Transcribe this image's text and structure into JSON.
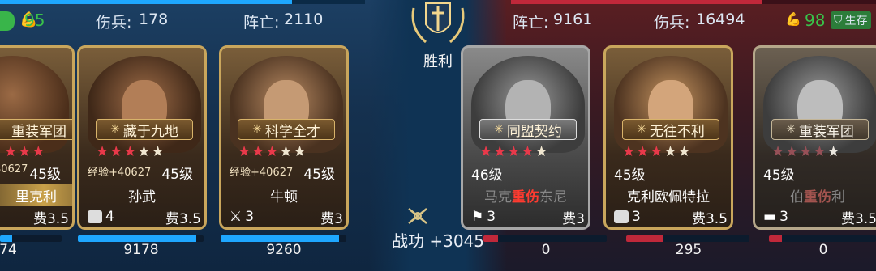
{
  "left": {
    "morale": "95",
    "wounded_label": "伤兵:",
    "wounded": "178",
    "dead_label": "阵亡:",
    "dead": "2110",
    "cards": [
      {
        "tag": "重装军团",
        "exp": "40627",
        "level": "45级",
        "name": "里克利",
        "troops": "",
        "cost": "费3.5",
        "hp": "74",
        "stars": 5,
        "stars_on": 3
      },
      {
        "tag": "藏于九地",
        "exp": "经验+40627",
        "level": "45级",
        "name": "孙武",
        "troops": "4",
        "cost": "费3.5",
        "hp": "9178",
        "stars": 5,
        "stars_on": 3
      },
      {
        "tag": "科学全才",
        "exp": "经验+40627",
        "level": "45级",
        "name": "牛顿",
        "troops": "3",
        "cost": "费3",
        "hp": "9260",
        "stars": 5,
        "stars_on": 3
      }
    ]
  },
  "center": {
    "result": "胜利",
    "merit_label": "战功",
    "merit_value": "+3045"
  },
  "right": {
    "dead_label": "阵亡:",
    "dead": "9161",
    "wounded_label": "伤兵:",
    "wounded": "16494",
    "morale": "98",
    "survive_label": "生存",
    "cards": [
      {
        "tag": "同盟契约",
        "level": "46级",
        "name_faded": "马克",
        "status": "重伤",
        "name_faded2": "东尼",
        "troops": "3",
        "cost": "费3",
        "hp": "0",
        "stars": 5,
        "stars_on": 4
      },
      {
        "tag": "无往不利",
        "level": "45级",
        "name": "克利欧佩特拉",
        "troops": "3",
        "cost": "费3.5",
        "hp": "295",
        "stars": 5,
        "stars_on": 3
      },
      {
        "tag": "重装军团",
        "level": "45级",
        "name_faded": "伯",
        "status": "重伤",
        "name_faded2": "利",
        "troops": "3",
        "cost": "费3.5",
        "hp": "0",
        "stars": 5,
        "stars_on": 4
      }
    ]
  },
  "colors": {
    "left_accent": "#1ea7ff",
    "right_accent": "#c0283a",
    "star_on": "#e8394a",
    "morale_green": "#39b54a"
  }
}
